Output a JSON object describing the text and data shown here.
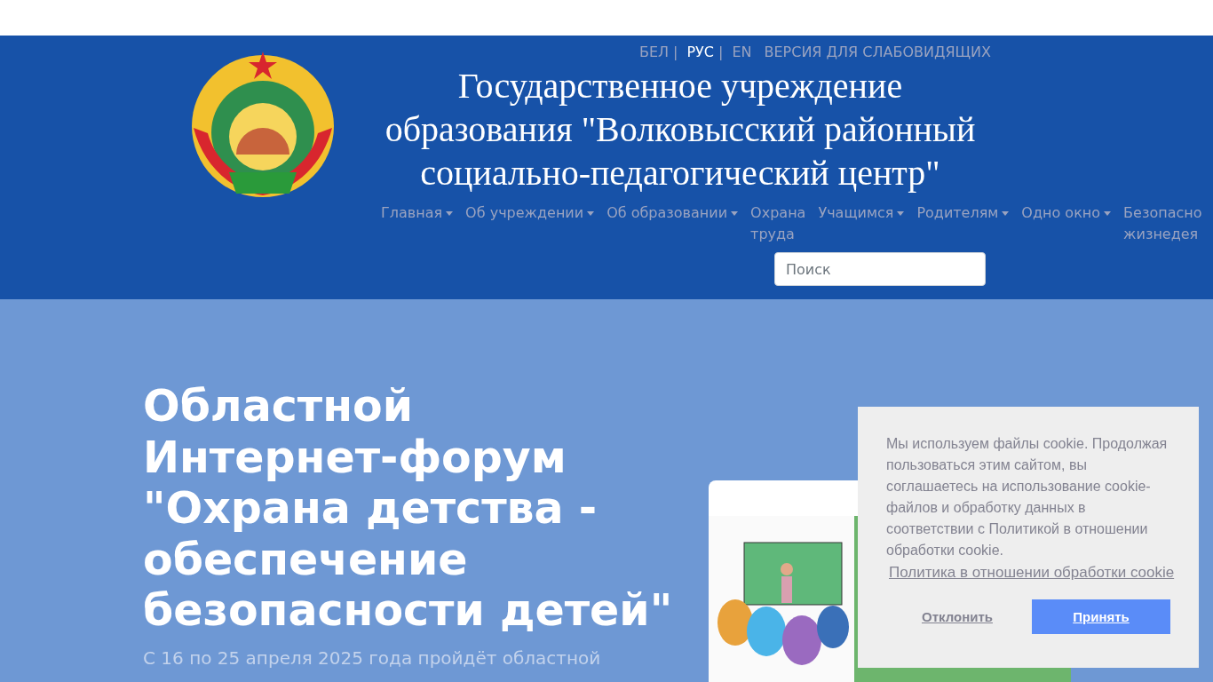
{
  "languages": [
    {
      "label": "БЕЛ",
      "separator": "|",
      "selected": false
    },
    {
      "label": "РУС",
      "separator": "|",
      "selected": true
    },
    {
      "label": "EN",
      "selected": false
    }
  ],
  "accessibility_link": "ВЕРСИЯ ДЛЯ СЛАБОВИДЯЩИХ",
  "site_title": "Государственное учреждение образования \"Волковысский районный социально-педагогический центр\"",
  "nav": [
    {
      "label": "Главная",
      "dropdown": true
    },
    {
      "label": "Об учреждении",
      "dropdown": true
    },
    {
      "label": "Об образовании",
      "dropdown": true
    },
    {
      "label": "Охрана труда",
      "dropdown": false
    },
    {
      "label": "Учащимся",
      "dropdown": true
    },
    {
      "label": "Родителям",
      "dropdown": true
    },
    {
      "label": "Одно окно",
      "dropdown": true
    },
    {
      "label": "Безопасно жизнедея",
      "dropdown": false
    }
  ],
  "search": {
    "placeholder": "Поиск"
  },
  "hero": {
    "title": "Областной Интернет-форум \"Охрана детства - обеспечение безопасности детей\"",
    "text": "С 16 по 25 апреля 2025 года пройдёт областной"
  },
  "cookie_banner": {
    "message": "Мы используем файлы cookie. Продолжая пользоваться этим сайтом, вы соглашаетесь на использование cookie-файлов и обработку данных в соответствии с Политикой в отношении обработки cookie.",
    "policy_link": "Политика в отношении обработки cookie",
    "decline": "Отклонить",
    "accept": "Принять"
  }
}
